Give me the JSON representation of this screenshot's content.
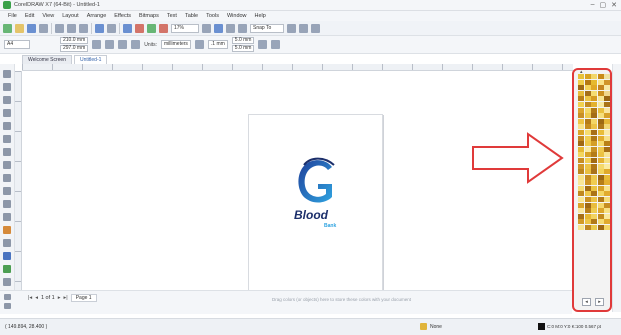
{
  "window": {
    "title": "CorelDRAW X7 (64-Bit) - Untitled-1",
    "controls": [
      "–",
      "▢",
      "✕"
    ]
  },
  "menu": [
    "File",
    "Edit",
    "View",
    "Layout",
    "Arrange",
    "Effects",
    "Bitmaps",
    "Text",
    "Table",
    "Tools",
    "Window",
    "Help"
  ],
  "toolbar": {
    "zoom": "17%",
    "snap_to": "Snap To"
  },
  "propbar": {
    "paper": "A4",
    "width": "210.0 mm",
    "height": "297.0 mm",
    "units_label": "Units:",
    "units": "millimeters",
    "nudge": ".1 mm",
    "dup_x": "5.0 mm",
    "dup_y": "5.0 mm"
  },
  "tabs": [
    "Welcome Screen",
    "Untitled-1"
  ],
  "logo": {
    "text": "Blood",
    "sub": "Bank"
  },
  "pager": {
    "first": "|◂",
    "prev": "◂",
    "page_of": "1 of 1",
    "next": "▸",
    "last": "▸|",
    "page_tab": "Page 1"
  },
  "bottom_hint": "Drag colors (or objects) here to store these colors with your document",
  "status": {
    "coords": "( 149.894, 28.400 )",
    "fill": "None",
    "color_info": "C:0 M:0 Y:0 K:100  0.567 pt"
  },
  "palette": {
    "top_marker": "▴",
    "controls": [
      "◂",
      "▸"
    ],
    "colors": [
      "#e8c23a",
      "#d9a321",
      "#f2d76a",
      "#c98b19",
      "#efe2a0",
      "#f0cf4a",
      "#b47a12",
      "#e6b92e",
      "#fae38a",
      "#d1952a",
      "#9f6a12",
      "#f3d35a",
      "#e0a825",
      "#c48420",
      "#f7e9a8",
      "#e7bd3b",
      "#a5701b",
      "#f5dc72",
      "#cc8f1e",
      "#f0d68c",
      "#b97f18",
      "#ecc648",
      "#d69c23",
      "#f8e592",
      "#9a6512",
      "#f1d150",
      "#c28a22",
      "#e3b230",
      "#f9eaa0",
      "#aa7418",
      "#dca42a",
      "#f4d96a",
      "#b27a16",
      "#e9c03e",
      "#fae6a0",
      "#c98f24",
      "#efcb4e",
      "#a36c14",
      "#f6df7c",
      "#d7a02a",
      "#eec445",
      "#b57c1a",
      "#f3d565",
      "#9d6812",
      "#e5b636",
      "#f8e38a",
      "#c68c20",
      "#ecc247",
      "#af7718",
      "#f2d877",
      "#dba629",
      "#f6dc70",
      "#a86f16",
      "#e8bd3a",
      "#fbeaa6",
      "#c38920",
      "#f0cd52",
      "#b07816",
      "#e2ad2e",
      "#f7e18a",
      "#9f6814",
      "#eec84a",
      "#d49d27",
      "#f5da6e",
      "#b98118",
      "#e6b934",
      "#faeba4",
      "#c99124",
      "#efc84c",
      "#a66e15",
      "#f3d660",
      "#d8a22a",
      "#b47c19",
      "#ebc243",
      "#f8e595",
      "#c88e22",
      "#f1cf55",
      "#a26b13",
      "#e4b031",
      "#f6df82",
      "#d09726",
      "#edc448",
      "#b07717",
      "#f4d86a",
      "#faeba0",
      "#bd861d",
      "#e9bf3f",
      "#a9721a",
      "#f2d35c",
      "#dfa92b",
      "#f7e287",
      "#c48b21",
      "#eec94c",
      "#9b6613",
      "#e7ba37",
      "#f9e79a",
      "#cf9525",
      "#f0cc50",
      "#b57d19",
      "#e3af30",
      "#f5dc74",
      "#a46d15",
      "#ebc342",
      "#d7a028",
      "#f8e48e",
      "#c08820",
      "#efc94d",
      "#ab7316",
      "#f3d663",
      "#e1ac2e",
      "#f9e896",
      "#cb9123",
      "#ecc345",
      "#b27a18",
      "#f6dd78",
      "#d9a32a",
      "#a06914",
      "#e9bd3d",
      "#f4d86c",
      "#c68d21",
      "#fae9a2",
      "#b8801a",
      "#eecb4f",
      "#dca62b",
      "#f7e184",
      "#a77016",
      "#e6b833",
      "#f2d35e",
      "#c28a1f",
      "#f9e89c",
      "#d39b27",
      "#edc547",
      "#b17918",
      "#f5db72",
      "#e0aa2d",
      "#f8e590",
      "#c08722",
      "#eaca4b",
      "#9e6712",
      "#f3d666"
    ]
  }
}
